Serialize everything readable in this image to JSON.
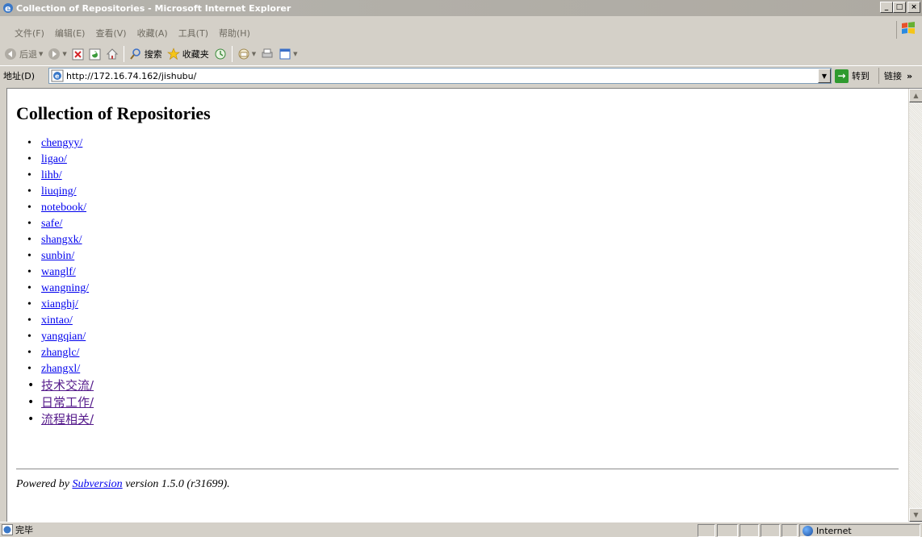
{
  "window": {
    "title": "Collection of Repositories - Microsoft Internet Explorer",
    "buttons": {
      "minimize": "_",
      "maximize": "□",
      "close": "×"
    }
  },
  "menu": [
    "文件(F)",
    "编辑(E)",
    "查看(V)",
    "收藏(A)",
    "工具(T)",
    "帮助(H)"
  ],
  "toolbar": {
    "back": "后退",
    "search": "搜索",
    "favorites": "收藏夹"
  },
  "address": {
    "label": "地址(D)",
    "url": "http://172.16.74.162/jishubu/",
    "go": "转到",
    "links": "链接",
    "links_more": "»"
  },
  "page": {
    "heading": "Collection of Repositories",
    "repos": [
      "chengyy/",
      "ligao/",
      "lihb/",
      "liuqing/",
      "notebook/",
      "safe/",
      "shangxk/",
      "sunbin/",
      "wanglf/",
      "wangning/",
      "xianghj/",
      "xintao/",
      "yangqian/",
      "zhanglc/",
      "zhangxl/"
    ],
    "repos_visited": [
      "技术交流/",
      "日常工作/",
      "流程相关/"
    ],
    "footer": {
      "prefix": "Powered by ",
      "link": "Subversion",
      "suffix": " version 1.5.0 (r31699)."
    }
  },
  "status": {
    "text": "完毕",
    "zone": "Internet"
  },
  "colors": {
    "link": "#0000ee",
    "visited": "#551a8b",
    "chrome": "#d4d0c8"
  }
}
